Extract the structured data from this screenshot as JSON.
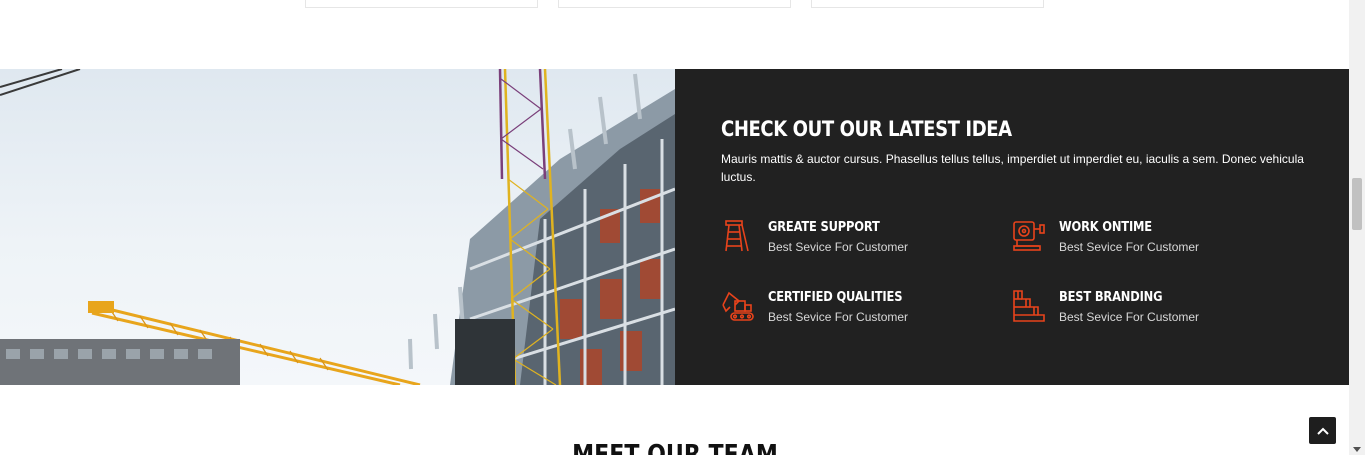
{
  "feature_section": {
    "title": "CHECK OUT OUR LATEST IDEA",
    "description": "Mauris mattis & auctor cursus. Phasellus tellus tellus, imperdiet ut imperdiet eu, iaculis a sem. Donec vehicula luctus.",
    "accent_color": "#e8431b",
    "panel_color": "#212121",
    "features": [
      {
        "icon": "ladder-icon",
        "title": "GREATE SUPPORT",
        "subtitle": "Best Sevice For Customer"
      },
      {
        "icon": "power-drill-icon",
        "title": "WORK ONTIME",
        "subtitle": "Best Sevice For Customer"
      },
      {
        "icon": "excavator-icon",
        "title": "CERTIFIED QUALITIES",
        "subtitle": "Best Sevice For Customer"
      },
      {
        "icon": "stairs-icon",
        "title": "BEST BRANDING",
        "subtitle": "Best Sevice For Customer"
      }
    ]
  },
  "next_section": {
    "title": "MEET OUR TEAM"
  },
  "controls": {
    "back_to_top_icon": "chevron-up-icon"
  }
}
